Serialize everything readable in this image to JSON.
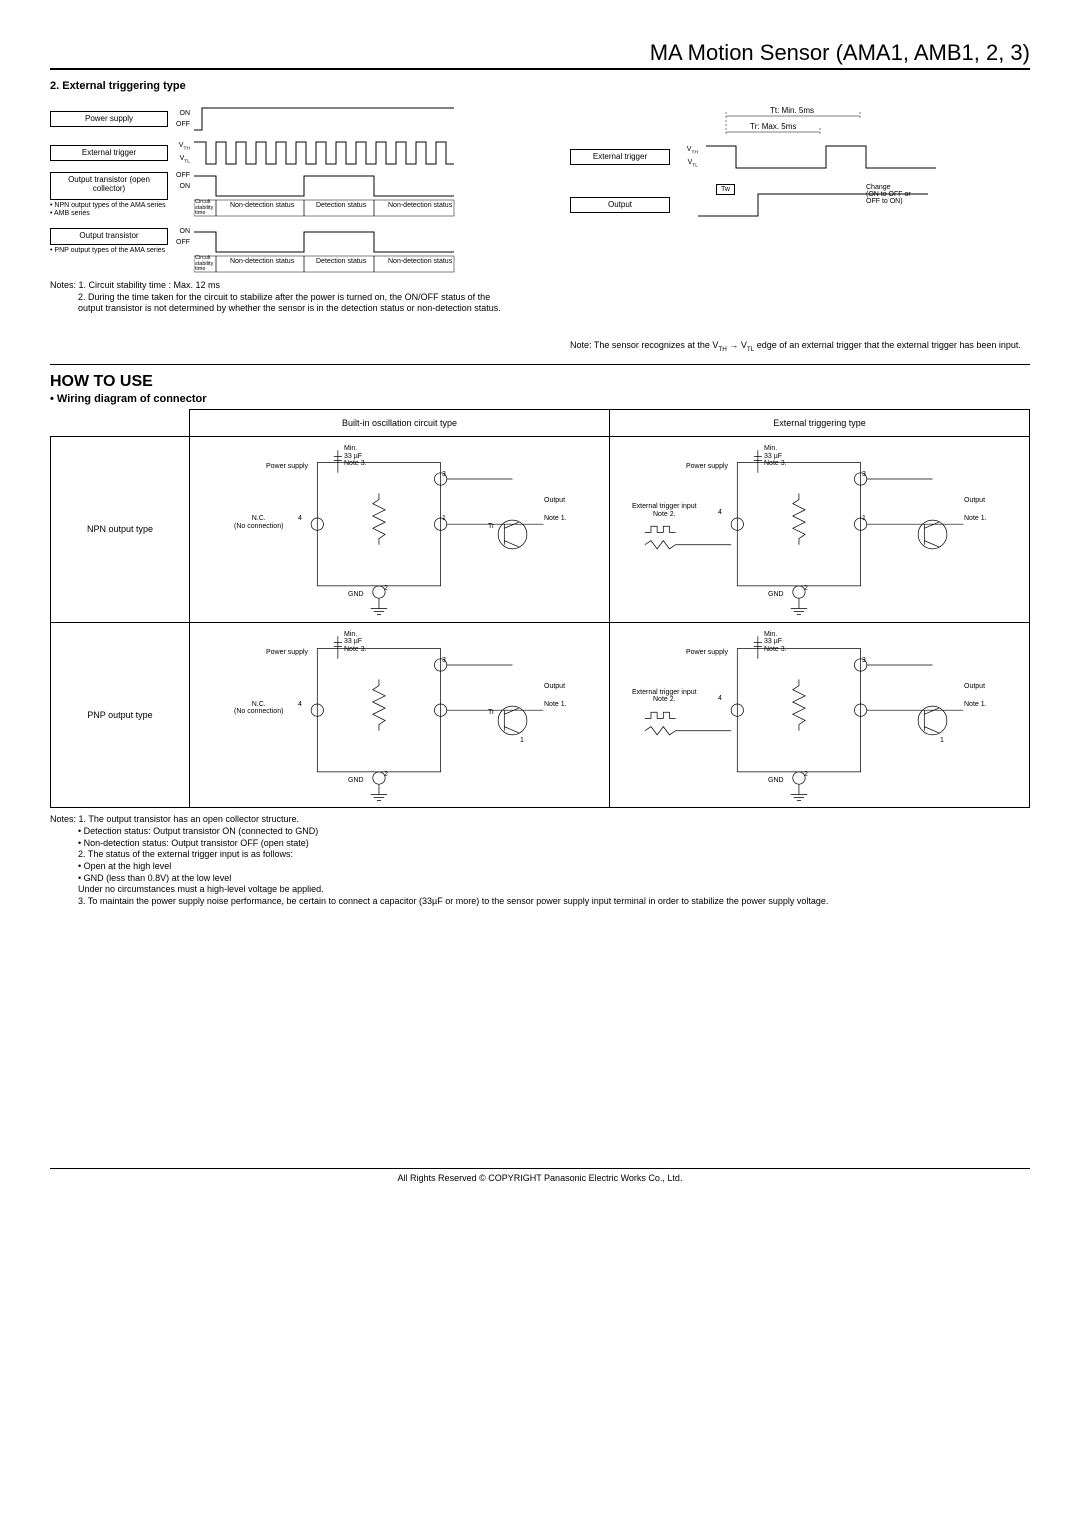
{
  "page_title": "MA Motion Sensor (AMA1, AMB1, 2, 3)",
  "section2_heading": "2. External triggering type",
  "timing_left": {
    "rows": [
      {
        "label": "Power supply",
        "hi": "ON",
        "lo": "OFF",
        "sub": ""
      },
      {
        "label": "External trigger",
        "hi": "V",
        "hi_sub": "TH",
        "lo": "V",
        "lo_sub": "TL",
        "sub": ""
      },
      {
        "label": "Output transistor (open collector)",
        "hi": "OFF",
        "lo": "ON",
        "sub": "• NPN output types of the AMA series\n• AMB series"
      },
      {
        "label": "Output transistor",
        "hi": "ON",
        "lo": "OFF",
        "sub": "• PNP output types of the AMA series"
      }
    ],
    "cells": [
      "Circuit stability time",
      "Non-detection status",
      "Detection status",
      "Non-detection status"
    ]
  },
  "timing_left_notes": [
    "Notes: 1. Circuit stability time : Max. 12 ms",
    "2. During the time taken for the circuit to stabilize after the power is turned on, the ON/OFF status of the output transistor is not determined by whether the sensor is in the detection status or non-detection status."
  ],
  "timing_right": {
    "top_label_tt": "Tt: Min. 5ms",
    "top_label_tr": "Tr: Max. 5ms",
    "ext_trigger": "External trigger",
    "vth": "V",
    "vth_sub": "TH",
    "vtl": "V",
    "vtl_sub": "TL",
    "tw": "Tw",
    "output": "Output",
    "change": "Change\n(ON to OFF or\nOFF to ON)"
  },
  "timing_right_note": "Note: The sensor recognizes at the V",
  "timing_right_note_mid1": "TH",
  "timing_right_note_arrow": " → V",
  "timing_right_note_mid2": "TL",
  "timing_right_note_end": " edge of an external trigger that the external trigger has been input.",
  "howto": "HOW TO USE",
  "wiring_heading": "• Wiring diagram of connector",
  "wiring_table": {
    "col1": "Built-in oscillation circuit type",
    "col2": "External triggering type",
    "row1": "NPN output type",
    "row2": "PNP output type"
  },
  "circuit_labels": {
    "cap": "Min.\n33 µF\nNote 3.",
    "power": "Power supply",
    "pin3": "3",
    "pin4": "4",
    "pin2": "2",
    "pin1": "1",
    "output": "Output",
    "note1": "Note 1.",
    "gnd": "GND",
    "tr": "Tr",
    "nc": "N.C.\n(No connection)",
    "ext": "External trigger input\nNote 2."
  },
  "wiring_notes": [
    "Notes: 1. The output transistor has an open collector structure.",
    "• Detection status: Output transistor ON (connected to GND)",
    "• Non-detection status: Output transistor OFF (open state)",
    "2. The status of the external trigger input is as follows:",
    "• Open at the high level",
    "• GND (less than 0.8V) at the low level",
    "Under no circumstances must a high-level voltage be applied.",
    "3. To maintain the power supply noise performance, be certain to connect a capacitor (33µF or more) to the sensor power supply input terminal in order to stabilize the power supply voltage."
  ],
  "footer": "All Rights Reserved © COPYRIGHT Panasonic Electric Works Co., Ltd."
}
